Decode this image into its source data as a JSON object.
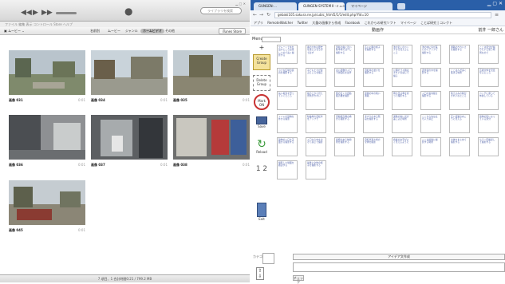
{
  "player": {
    "search_placeholder": "ライブラリを検索",
    "menubar": "ファイル  編集  表示  コントロール  Store  ヘルプ",
    "source_label": "ムービー",
    "tabs": [
      "名前別",
      "ムービー",
      "ジャンル",
      "ホームビデオ",
      "その他"
    ],
    "active_tab": 3,
    "store_button": "iTunes Store",
    "status": "7 項目、1 合計時間0:21 / 799.2 MB",
    "photos": [
      {
        "title": "画像 031",
        "duration": "0:01"
      },
      {
        "title": "画像 034",
        "duration": "0:01"
      },
      {
        "title": "画像 035",
        "duration": "0:01"
      },
      {
        "title": "画像 036",
        "duration": "0:01"
      },
      {
        "title": "画像 037",
        "duration": "0:01"
      },
      {
        "title": "画像 038",
        "duration": "0:01"
      },
      {
        "title": "画像 045",
        "duration": "0:01"
      }
    ]
  },
  "browser": {
    "tabs": [
      "GUNGEN-...",
      "GUNGEN-SYSTEM  Ⅱ -ミュニ",
      "マイページ"
    ],
    "url": "gebaki105.sakura.ne.jp/cubic_html5/1/1/edit.php?fid=10",
    "bookmarks": [
      "アプリ",
      "RemoteWatcher",
      "Twitter",
      "大量の画像から作成",
      "Facebook",
      "これからの研究ソフト",
      "マイページ",
      "ことば研究 | コレクト"
    ],
    "page_title": "動画作",
    "user": "前井 一郎さん",
    "menu_label": "Menu",
    "tools": {
      "create": "Create Group",
      "delete": "Delete Group",
      "mark": "Mark ON",
      "save": "Save",
      "reload": "Reload",
      "pages": "1 2",
      "exit": "Exit"
    },
    "idea_button": "アイデア文作成",
    "bottom_label": "カテゴリ",
    "check_button": "チェック"
  },
  "cards": [
    "クレーンで水を出すところは楽しいので長く撮影する",
    "奥の大木は歴史を感じさせるので必ず",
    "部屋の奥に近い駐車場では少し撮影する",
    "広い公園の様子を撮影する",
    "池の近くのベンチから見えるところ",
    "池の中に鳥が来たのでアップで撮影する",
    "通路のきれいさを撮影する",
    "ここは自分が撮りたいと思う場所なので",
    "小さな広場の遊具を撮影する",
    "子どもたちが遊ぶところを撮る",
    "古い建物の入口で雰囲気を出す",
    "自転車の並びを撮影する",
    "公園のゴミ箱はきれいな感じで撮る",
    "遊歩道の木を撮影する",
    "ここは人が多く集まる場所",
    "広場全体を見渡せるところ",
    "長い坂道を登っていくところ",
    "坂の上から見た景色がきれい",
    "駅の近くの自動販売機を撮影",
    "建物の中の暗い通路",
    "雨の日は傘を持って撮影する",
    "入口の案内板を撮影する",
    "植え込みの緑がきれいなところ",
    "ベンチに座って休憩している",
    "トイレの建物を外から撮影",
    "駐輪場の自転車をアップで",
    "自動販売機の横から撮影する",
    "手すりのある階段を撮影する",
    "通路の奥に光が差し込む場所",
    "ここから先は立ち入り禁止",
    "広い道路の向こうに見える",
    "建物の影になっている部分",
    "建物の入口を正面から撮影する",
    "入口から中をのぞく感じで撮影",
    "屋根のある休憩所を撮影する",
    "自転車置き場の全体を撮影",
    "看板の文字がよく見えるように",
    "ここは最後に撮影する場所",
    "全体をまとめて撮影する",
    "もう一度確認して撮影する",
    "撮影した場面を確認する",
    "最後に全体の様子を撮影する"
  ]
}
